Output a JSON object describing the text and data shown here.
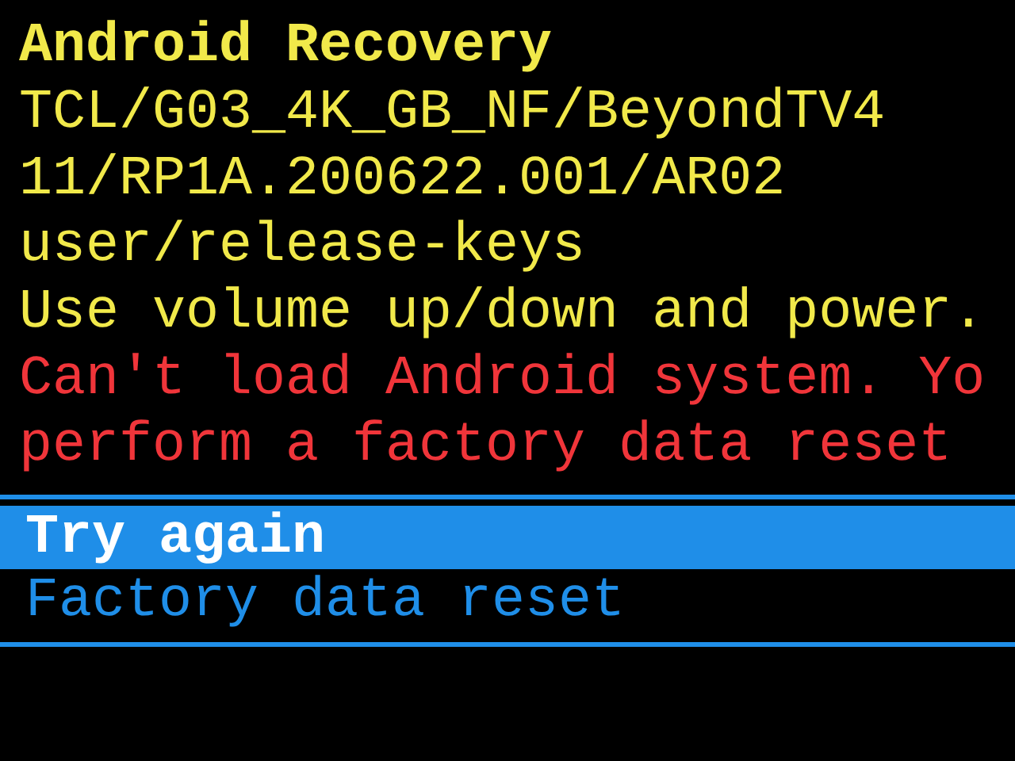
{
  "title": "Android Recovery",
  "lines": [
    {
      "kind": "info",
      "text": "TCL/G03_4K_GB_NF/BeyondTV4"
    },
    {
      "kind": "info",
      "text": "11/RP1A.200622.001/AR02"
    },
    {
      "kind": "info",
      "text": "user/release-keys"
    },
    {
      "kind": "info",
      "text": "Use volume up/down and power."
    },
    {
      "kind": "error",
      "text": "Can't load Android system. Yo"
    },
    {
      "kind": "error",
      "text": "perform a factory data reset"
    }
  ],
  "menu": [
    {
      "label": "Try again",
      "selected": true
    },
    {
      "label": "Factory data reset",
      "selected": false
    }
  ]
}
